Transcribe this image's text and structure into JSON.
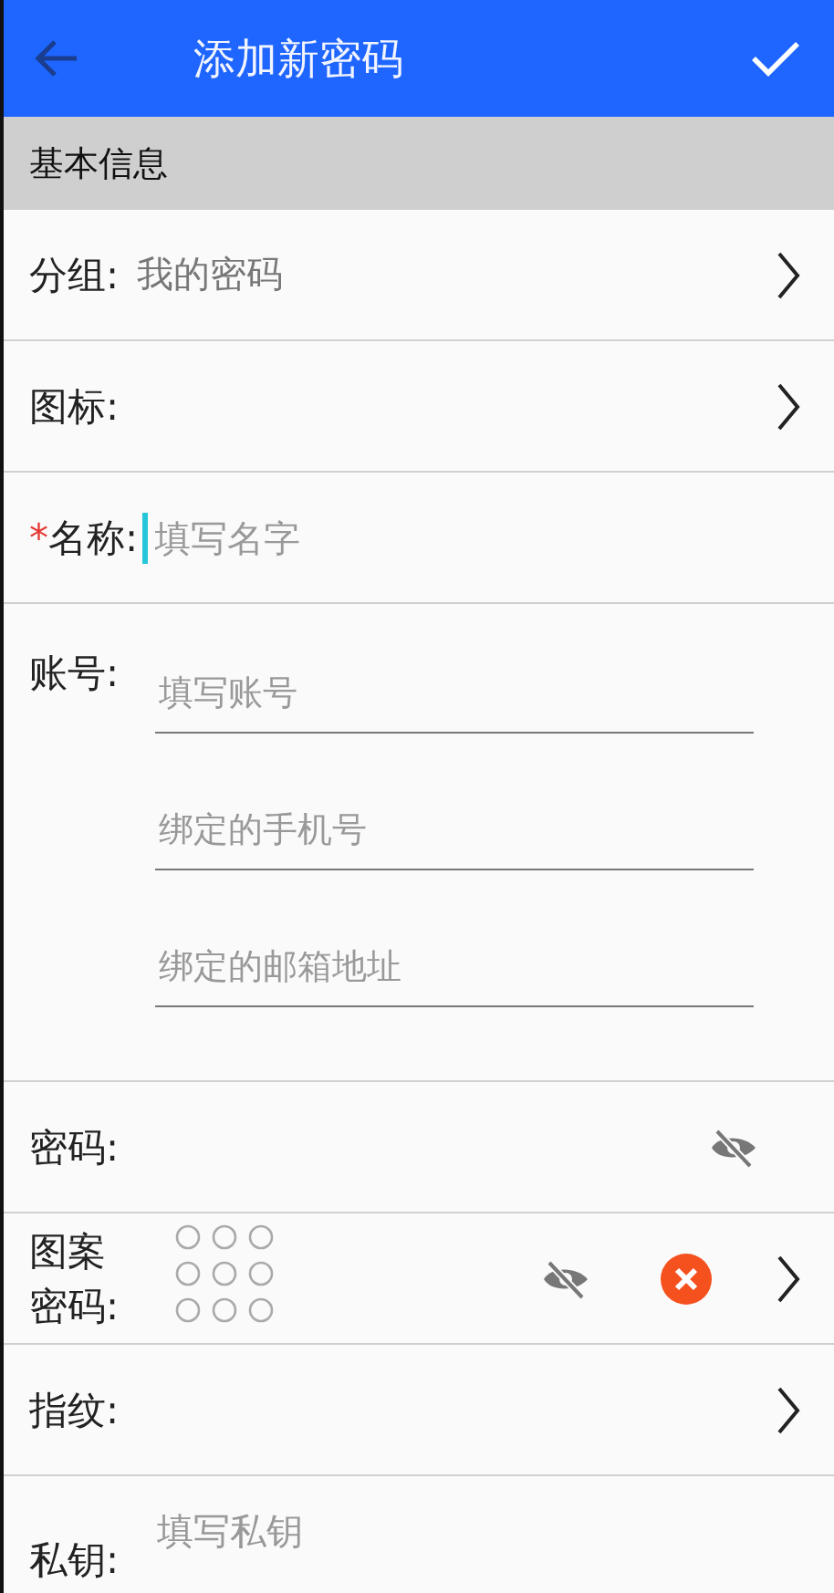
{
  "app_bar": {
    "title": "添加新密码"
  },
  "section": {
    "title": "基本信息"
  },
  "rows": [
    {
      "kind": "select",
      "label": "分组:",
      "value": "我的密码"
    },
    {
      "kind": "select",
      "label": "图标:"
    },
    {
      "kind": "text",
      "label": "名称:",
      "marker": "*",
      "placeholder": "填写名字",
      "focused": true
    },
    {
      "kind": "multi",
      "label": "账号:",
      "fields": [
        {
          "placeholder": "填写账号"
        },
        {
          "placeholder": "绑定的手机号"
        },
        {
          "placeholder": "绑定的邮箱地址"
        }
      ]
    },
    {
      "kind": "password",
      "label": "密码:",
      "revealed": false
    },
    {
      "kind": "pattern",
      "label": "图案密码:",
      "revealed": false
    },
    {
      "kind": "select",
      "label": "指纹:"
    },
    {
      "kind": "private",
      "label": "私钥:",
      "placeholder": "填写私钥"
    }
  ]
}
